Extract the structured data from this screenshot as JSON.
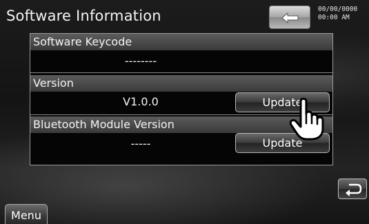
{
  "header": {
    "title": "Software Information",
    "clock_date": "00/00/0000",
    "clock_time": "00:00 AM",
    "back_icon": "back-arrow-icon"
  },
  "rows": {
    "keycode": {
      "label": "Software Keycode",
      "value": "--------"
    },
    "version": {
      "label": "Version",
      "value": "V1.0.0",
      "button": "Update"
    },
    "bluetooth": {
      "label": "Bluetooth Module Version",
      "value": "-----",
      "button": "Update"
    }
  },
  "footer": {
    "menu_label": "Menu",
    "return_icon": "return-arrow-icon"
  },
  "cursor_icon": "hand-pointer-icon"
}
